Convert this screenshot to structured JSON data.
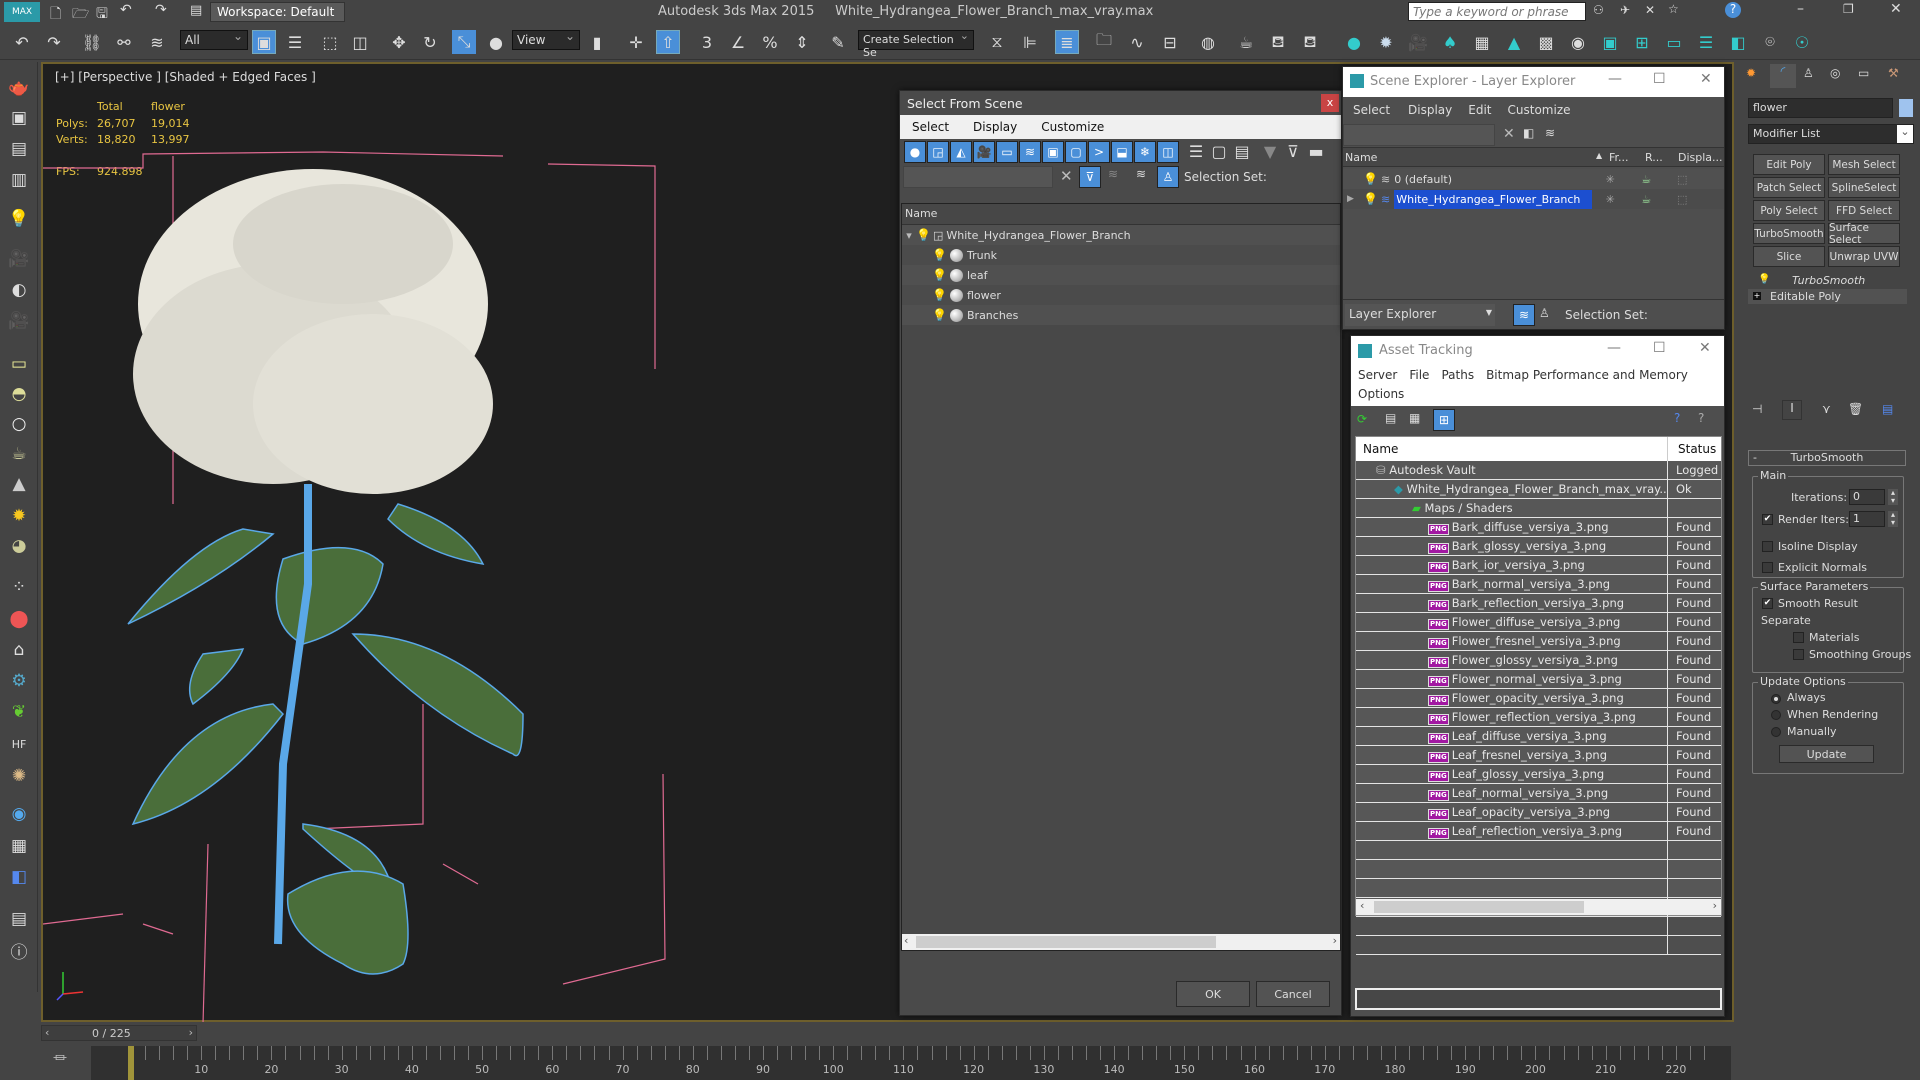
{
  "app": {
    "title": "Autodesk 3ds Max  2015",
    "file": "White_Hydrangea_Flower_Branch_max_vray.max",
    "workspace": "Workspace: Default",
    "search_placeholder": "Type a keyword or phrase"
  },
  "toolbar": {
    "selection_filter": "All",
    "ref_coord": "View",
    "selection_set": "Create Selection Se",
    "snap_3": "3",
    "snap_pct": "%"
  },
  "viewport": {
    "label": "[+] [Perspective ] [Shaded + Edged Faces ]",
    "stats_headers": [
      "Total",
      "flower"
    ],
    "polys_label": "Polys:",
    "polys_total": "26,707",
    "polys_sel": "19,014",
    "verts_label": "Verts:",
    "verts_total": "18,820",
    "verts_sel": "13,997",
    "fps_label": "FPS:",
    "fps_value": "924.898"
  },
  "select_from_scene": {
    "title": "Select From Scene",
    "close": "x",
    "menu": [
      "Select",
      "Display",
      "Customize"
    ],
    "selection_set_label": "Selection Set:",
    "col_name": "Name",
    "root": "White_Hydrangea_Flower_Branch",
    "children": [
      "Trunk",
      "leaf",
      "flower",
      "Branches"
    ],
    "ok": "OK",
    "cancel": "Cancel"
  },
  "scene_explorer": {
    "title": "Scene Explorer - Layer Explorer",
    "menu": [
      "Select",
      "Display",
      "Edit",
      "Customize"
    ],
    "cols": [
      "Name",
      "Fr...",
      "R...",
      "Displa..."
    ],
    "layers": [
      "0 (default)",
      "White_Hydrangea_Flower_Branch"
    ],
    "mode": "Layer Explorer",
    "selection_set_label": "Selection Set:"
  },
  "asset_tracking": {
    "title": "Asset Tracking",
    "menu": [
      "Server",
      "File",
      "Paths",
      "Bitmap Performance and Memory"
    ],
    "menu2": "Options",
    "cols": [
      "Name",
      "Status"
    ],
    "vault": {
      "name": "Autodesk Vault",
      "status": "Logged"
    },
    "file": {
      "name": "White_Hydrangea_Flower_Branch_max_vray....",
      "status": "Ok"
    },
    "group": "Maps / Shaders",
    "maps": [
      {
        "name": "Bark_diffuse_versiya_3.png",
        "status": "Found"
      },
      {
        "name": "Bark_glossy_versiya_3.png",
        "status": "Found"
      },
      {
        "name": "Bark_ior_versiya_3.png",
        "status": "Found"
      },
      {
        "name": "Bark_normal_versiya_3.png",
        "status": "Found"
      },
      {
        "name": "Bark_reflection_versiya_3.png",
        "status": "Found"
      },
      {
        "name": "Flower_diffuse_versiya_3.png",
        "status": "Found"
      },
      {
        "name": "Flower_fresnel_versiya_3.png",
        "status": "Found"
      },
      {
        "name": "Flower_glossy_versiya_3.png",
        "status": "Found"
      },
      {
        "name": "Flower_normal_versiya_3.png",
        "status": "Found"
      },
      {
        "name": "Flower_opacity_versiya_3.png",
        "status": "Found"
      },
      {
        "name": "Flower_reflection_versiya_3.png",
        "status": "Found"
      },
      {
        "name": "Leaf_diffuse_versiya_3.png",
        "status": "Found"
      },
      {
        "name": "Leaf_fresnel_versiya_3.png",
        "status": "Found"
      },
      {
        "name": "Leaf_glossy_versiya_3.png",
        "status": "Found"
      },
      {
        "name": "Leaf_normal_versiya_3.png",
        "status": "Found"
      },
      {
        "name": "Leaf_opacity_versiya_3.png",
        "status": "Found"
      },
      {
        "name": "Leaf_reflection_versiya_3.png",
        "status": "Found"
      }
    ]
  },
  "command_panel": {
    "object_name": "flower",
    "object_color": "#9fc3ee",
    "modifier_list": "Modifier List",
    "mod_buttons": [
      "Edit Poly",
      "Mesh Select",
      "Patch Select",
      "SplineSelect",
      "Poly Select",
      "FFD Select",
      "TurboSmooth",
      "Surface Select",
      "Slice",
      "Unwrap UVW"
    ],
    "stack": [
      "TurboSmooth",
      "Editable Poly"
    ],
    "rollout_title": "TurboSmooth",
    "main_label": "Main",
    "iterations_label": "Iterations:",
    "iterations": "0",
    "render_iters_label": "Render Iters:",
    "render_iters": "1",
    "render_iters_checked": true,
    "isoline": "Isoline Display",
    "explicit_normals": "Explicit Normals",
    "surface_params": "Surface Parameters",
    "smooth_result": "Smooth Result",
    "separate": "Separate",
    "materials": "Materials",
    "smoothing_groups": "Smoothing Groups",
    "update_options": "Update Options",
    "radio": [
      "Always",
      "When Rendering",
      "Manually"
    ],
    "radio_selected": "Always",
    "update_btn": "Update"
  },
  "timeline": {
    "frame": "0 / 225",
    "ticks": [
      "0",
      "10",
      "20",
      "30",
      "40",
      "50",
      "60",
      "70",
      "80",
      "90",
      "100",
      "110",
      "120",
      "130",
      "140",
      "150",
      "160",
      "170",
      "180",
      "190",
      "200",
      "210",
      "220"
    ]
  },
  "colors": {
    "accent": "#4a8fd8",
    "selection": "#1c4fd0",
    "stat_text": "#e8c542",
    "viewport_border": "#6e5f2c"
  }
}
